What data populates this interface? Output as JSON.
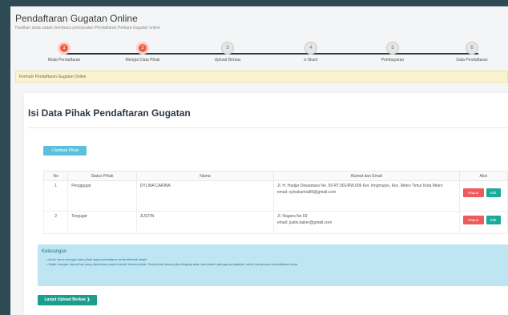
{
  "header": {
    "title": "Pendaftaran Gugatan Online",
    "subtitle": "Pastikan anda sudah membaca persyaratan Pendaftaran Perkara Gugatan online"
  },
  "steps": [
    {
      "num": "1",
      "label": "Mulai Pendaftaran",
      "active": true
    },
    {
      "num": "2",
      "label": "Mengisi Data Pihak",
      "active": true
    },
    {
      "num": "3",
      "label": "Upload Berkas",
      "active": false
    },
    {
      "num": "4",
      "label": "e-Skum",
      "active": false
    },
    {
      "num": "5",
      "label": "Pembayaran",
      "active": false
    },
    {
      "num": "6",
      "label": "Data Pendaftaran",
      "active": false
    }
  ],
  "alert": "Formulir Pendaftaran Gugatan Online",
  "card": {
    "title": "Isi Data Pihak Pendaftaran Gugatan",
    "add_button": "+Tambah Pihak"
  },
  "table": {
    "headers": [
      "No",
      "Status Pihak",
      "Nama",
      "Alamat dan Email",
      "Aksi"
    ],
    "rows": [
      {
        "no": "1",
        "status": "Penggugat",
        "nama": "DYLINA CARINA",
        "alamat": "Jl. H. Hadjar Dewantara No. 69 RT.001/RW.006 Kel. Iringmulyo, Kec. Metro Timur Kota Metro",
        "email": "email: sylvakarina85@gmail.com"
      },
      {
        "no": "2",
        "status": "Tergugat",
        "nama": "JUSTIN",
        "alamat": "Jl. Nagara No 69",
        "email": "email: justin.baker@gmail.com"
      }
    ],
    "delete_label": "Hapus",
    "edit_label": "Edit"
  },
  "info": {
    "title": "Keterangan",
    "items": [
      "Anda harus mengisi data pihak agar pendaftaran anda ditindak lanjuti",
      "Wajib mengisi data pihak yang diperlukan pada formulir tombol pihak. Data pihak lainnya jika lengkap akan membantu petugas pengadilan untuk memproses pendaftaran anda"
    ]
  },
  "next_button": "Lanjut Upload Berkas ❯",
  "colors": {
    "active_step": "#f05a4a",
    "primary_teal": "#1a9e8e",
    "info_bg": "#bde5f2",
    "danger": "#ef5a5a"
  }
}
